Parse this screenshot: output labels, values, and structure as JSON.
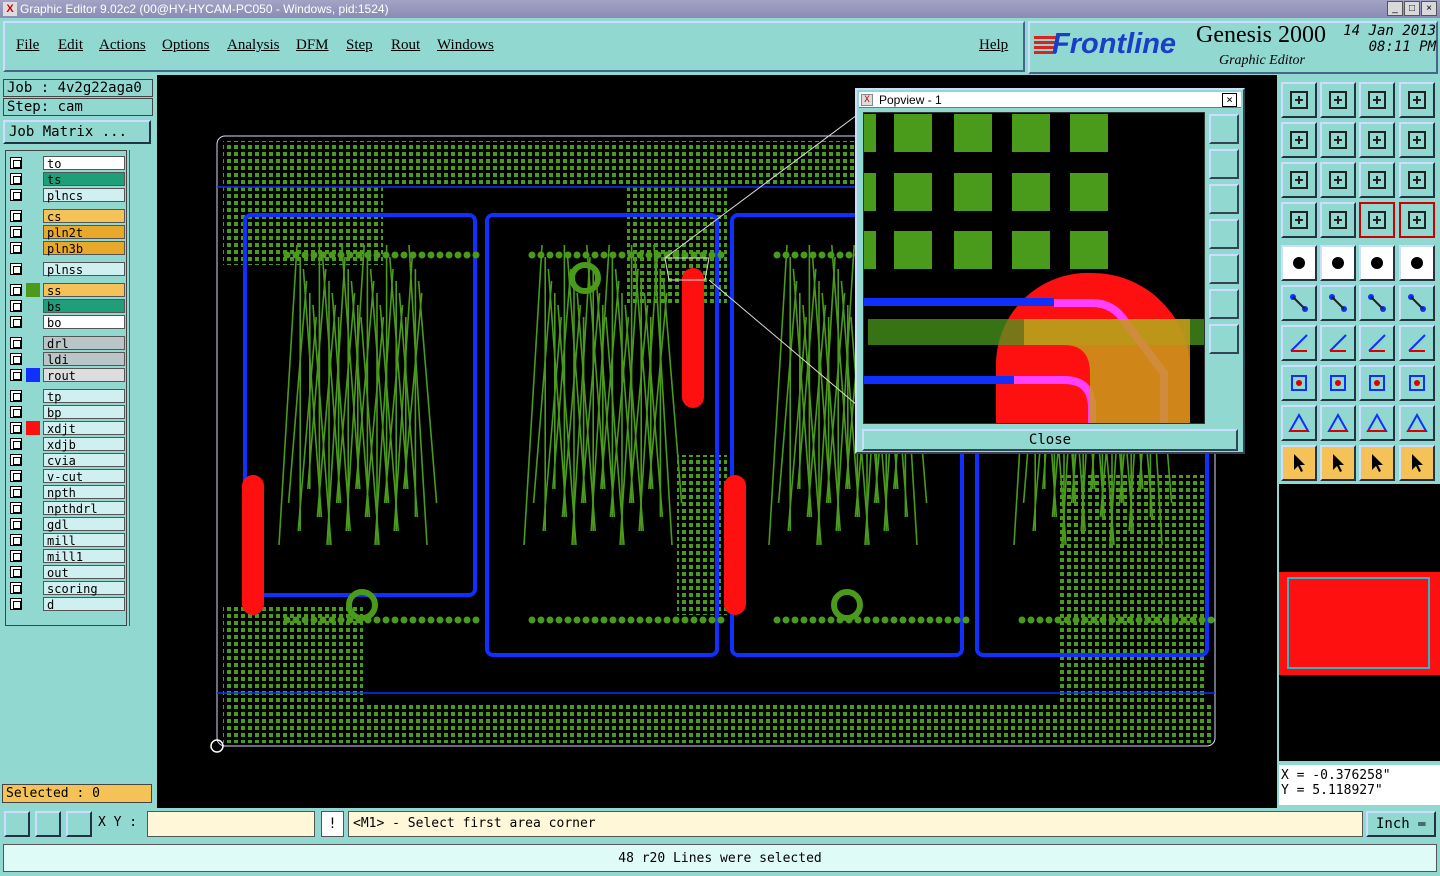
{
  "window": {
    "title": "Graphic Editor 9.02c2 (00@HY-HYCAM-PC050 - Windows, pid:1524)"
  },
  "menu": [
    {
      "label": "File"
    },
    {
      "label": "Edit"
    },
    {
      "label": "Actions"
    },
    {
      "label": "Options"
    },
    {
      "label": "Analysis"
    },
    {
      "label": "DFM"
    },
    {
      "label": "Step"
    },
    {
      "label": "Rout"
    },
    {
      "label": "Windows"
    },
    {
      "label": "Help"
    }
  ],
  "brand": {
    "logo": "Frontline",
    "product": "Genesis 2000",
    "subtitle": "Graphic Editor",
    "date": "14 Jan 2013",
    "time": "08:11 PM"
  },
  "job": {
    "job_line": "Job : 4v2g22aga0",
    "step_line": "Step: cam",
    "matrix_button": "Job Matrix ..."
  },
  "layers": [
    {
      "name": "to",
      "color": "#ffffff",
      "swatch": ""
    },
    {
      "name": "ts",
      "color": "#1f9e7a",
      "swatch": ""
    },
    {
      "name": "plncs",
      "color": "#cfeff0",
      "swatch": ""
    },
    {
      "name": "cs",
      "color": "#f4c257",
      "swatch": ""
    },
    {
      "name": "pln2t",
      "color": "#e8a92a",
      "swatch": ""
    },
    {
      "name": "pln3b",
      "color": "#e8a92a",
      "swatch": ""
    },
    {
      "name": "plnss",
      "color": "#cfeff0",
      "swatch": ""
    },
    {
      "name": "ss",
      "color": "#f4c257",
      "swatch": "#4a9a1c"
    },
    {
      "name": "bs",
      "color": "#1f9e7a",
      "swatch": ""
    },
    {
      "name": "bo",
      "color": "#ffffff",
      "swatch": ""
    },
    {
      "name": "drl",
      "color": "#b9c5c7",
      "swatch": ""
    },
    {
      "name": "ldi",
      "color": "#b9c5c7",
      "swatch": ""
    },
    {
      "name": "rout",
      "color": "#dddddd",
      "swatch": "#1030ff"
    },
    {
      "name": "tp",
      "color": "#cfeff0",
      "swatch": ""
    },
    {
      "name": "bp",
      "color": "#cfeff0",
      "swatch": ""
    },
    {
      "name": "xdjt",
      "color": "#cfeff0",
      "swatch": "#ff1010"
    },
    {
      "name": "xdjb",
      "color": "#cfeff0",
      "swatch": ""
    },
    {
      "name": "cvia",
      "color": "#cfeff0",
      "swatch": ""
    },
    {
      "name": "v-cut",
      "color": "#cfeff0",
      "swatch": ""
    },
    {
      "name": "npth",
      "color": "#cfeff0",
      "swatch": ""
    },
    {
      "name": "npthdrl",
      "color": "#cfeff0",
      "swatch": ""
    },
    {
      "name": "gdl",
      "color": "#cfeff0",
      "swatch": ""
    },
    {
      "name": "mill",
      "color": "#cfeff0",
      "swatch": ""
    },
    {
      "name": "mill1",
      "color": "#cfeff0",
      "swatch": ""
    },
    {
      "name": "out",
      "color": "#cfeff0",
      "swatch": ""
    },
    {
      "name": "scoring",
      "color": "#cfeff0",
      "swatch": ""
    },
    {
      "name": "d",
      "color": "#cfeff0",
      "swatch": ""
    }
  ],
  "selected": "Selected : 0",
  "popview": {
    "title": "Popview - 1",
    "close_label": "Close"
  },
  "coords": {
    "x": "X = -0.376258\"",
    "y": "Y = 5.118927\""
  },
  "xy_label": "X Y :",
  "xy_value": "",
  "info_icon": "!",
  "prompt": "<M1> - Select first area corner",
  "unit": "Inch",
  "status": "48 r20 Lines were selected",
  "colors": {
    "panel": "#90d8d0",
    "pad": "#4a9a1c",
    "rout": "#1030ff",
    "highlight": "#ff1010",
    "selection": "#f4c257"
  }
}
